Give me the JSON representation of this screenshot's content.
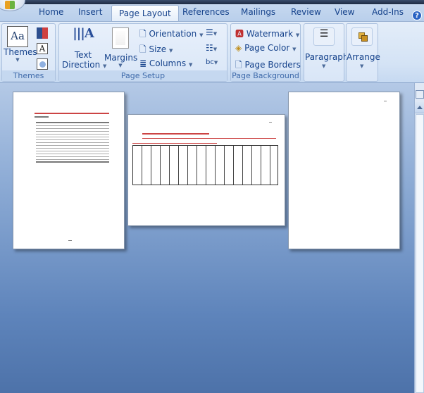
{
  "tabs": [
    {
      "label": "Home"
    },
    {
      "label": "Insert"
    },
    {
      "label": "Page Layout",
      "active": true
    },
    {
      "label": "References"
    },
    {
      "label": "Mailings"
    },
    {
      "label": "Review"
    },
    {
      "label": "View"
    },
    {
      "label": "Add-Ins"
    }
  ],
  "help_icon": "help-icon",
  "ribbon": {
    "themes": {
      "label": "Themes",
      "button": "Themes"
    },
    "page_setup": {
      "label": "Page Setup",
      "text_direction_1": "Text",
      "text_direction_2": "Direction",
      "margins": "Margins",
      "orientation": "Orientation",
      "size": "Size",
      "columns": "Columns"
    },
    "page_background": {
      "label": "Page Background",
      "watermark": "Watermark",
      "page_color": "Page Color",
      "page_borders": "Page Borders"
    },
    "paragraph": "Paragraph",
    "arrange": "Arrange"
  },
  "colors": {
    "accent": "#15428b",
    "doc_bg_top": "#b4c9e6",
    "doc_bg_bottom": "#4d72a9"
  }
}
